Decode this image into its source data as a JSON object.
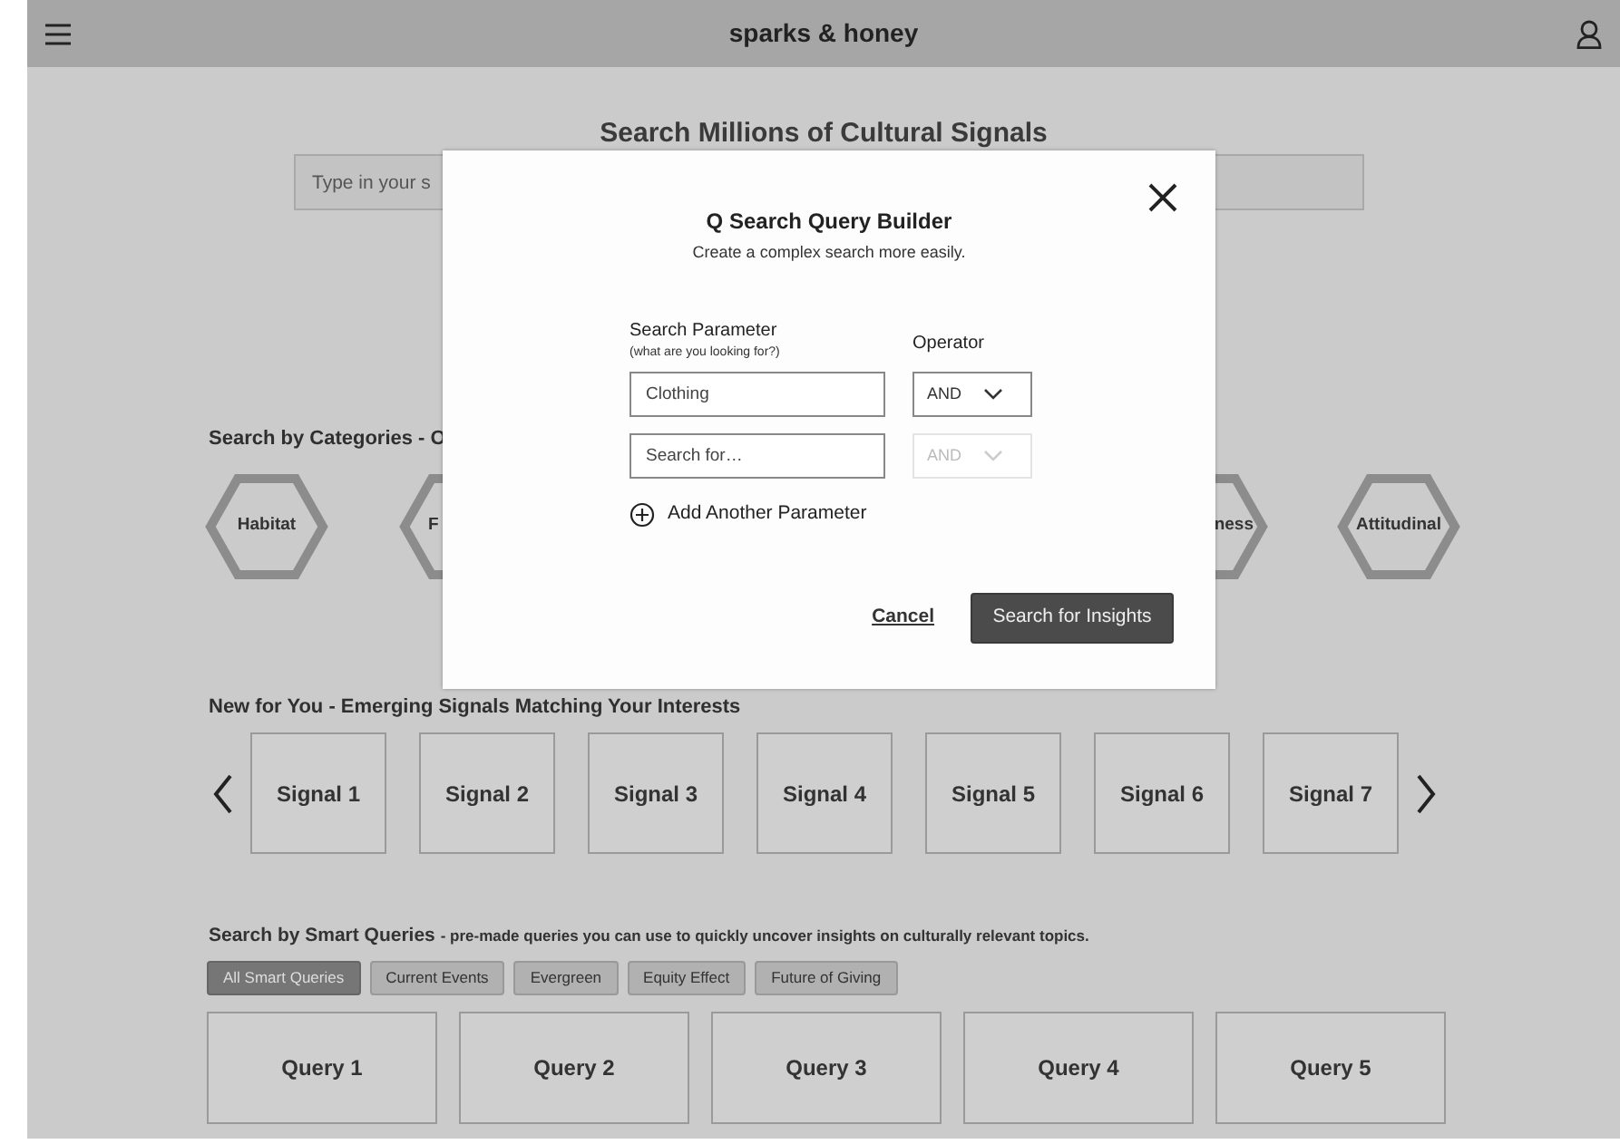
{
  "header": {
    "title": "sparks & honey"
  },
  "hero": {
    "title": "Search Millions of Cultural Signals",
    "search": {
      "placeholder": "Type in your s"
    }
  },
  "categories": {
    "heading": "Search by Categories - O",
    "items": [
      {
        "label": "Habitat",
        "kind": "whole"
      },
      {
        "label": "F",
        "kind": "clipright"
      },
      {
        "label": "ness",
        "kind": "clipleft"
      },
      {
        "label": "Attitudinal",
        "kind": "whole"
      }
    ]
  },
  "signals": {
    "heading": "New for You - Emerging Signals Matching Your Interests",
    "items": [
      "Signal 1",
      "Signal 2",
      "Signal 3",
      "Signal 4",
      "Signal 5",
      "Signal 6",
      "Signal 7"
    ]
  },
  "smart_queries": {
    "heading": "Search by Smart Queries",
    "description": "- pre-made queries you can use to quickly uncover insights on culturally relevant topics.",
    "filters": [
      {
        "label": "All Smart Queries",
        "selected": true
      },
      {
        "label": "Current Events",
        "selected": false
      },
      {
        "label": "Evergreen",
        "selected": false
      },
      {
        "label": "Equity Effect",
        "selected": false
      },
      {
        "label": "Future of Giving",
        "selected": false
      }
    ],
    "queries": [
      "Query 1",
      "Query 2",
      "Query 3",
      "Query 4",
      "Query 5"
    ]
  },
  "modal": {
    "title": "Q Search Query Builder",
    "subtitle": "Create a complex search more easily.",
    "param_label": "Search Parameter",
    "param_hint": "(what are you looking for?)",
    "operator_label": "Operator",
    "rows": [
      {
        "value": "Clothing",
        "operator": "AND",
        "disabled": false
      },
      {
        "placeholder": "Search for…",
        "operator": "AND",
        "disabled": true
      }
    ],
    "add_label": "Add Another Parameter",
    "cancel": "Cancel",
    "submit": "Search for Insights"
  }
}
